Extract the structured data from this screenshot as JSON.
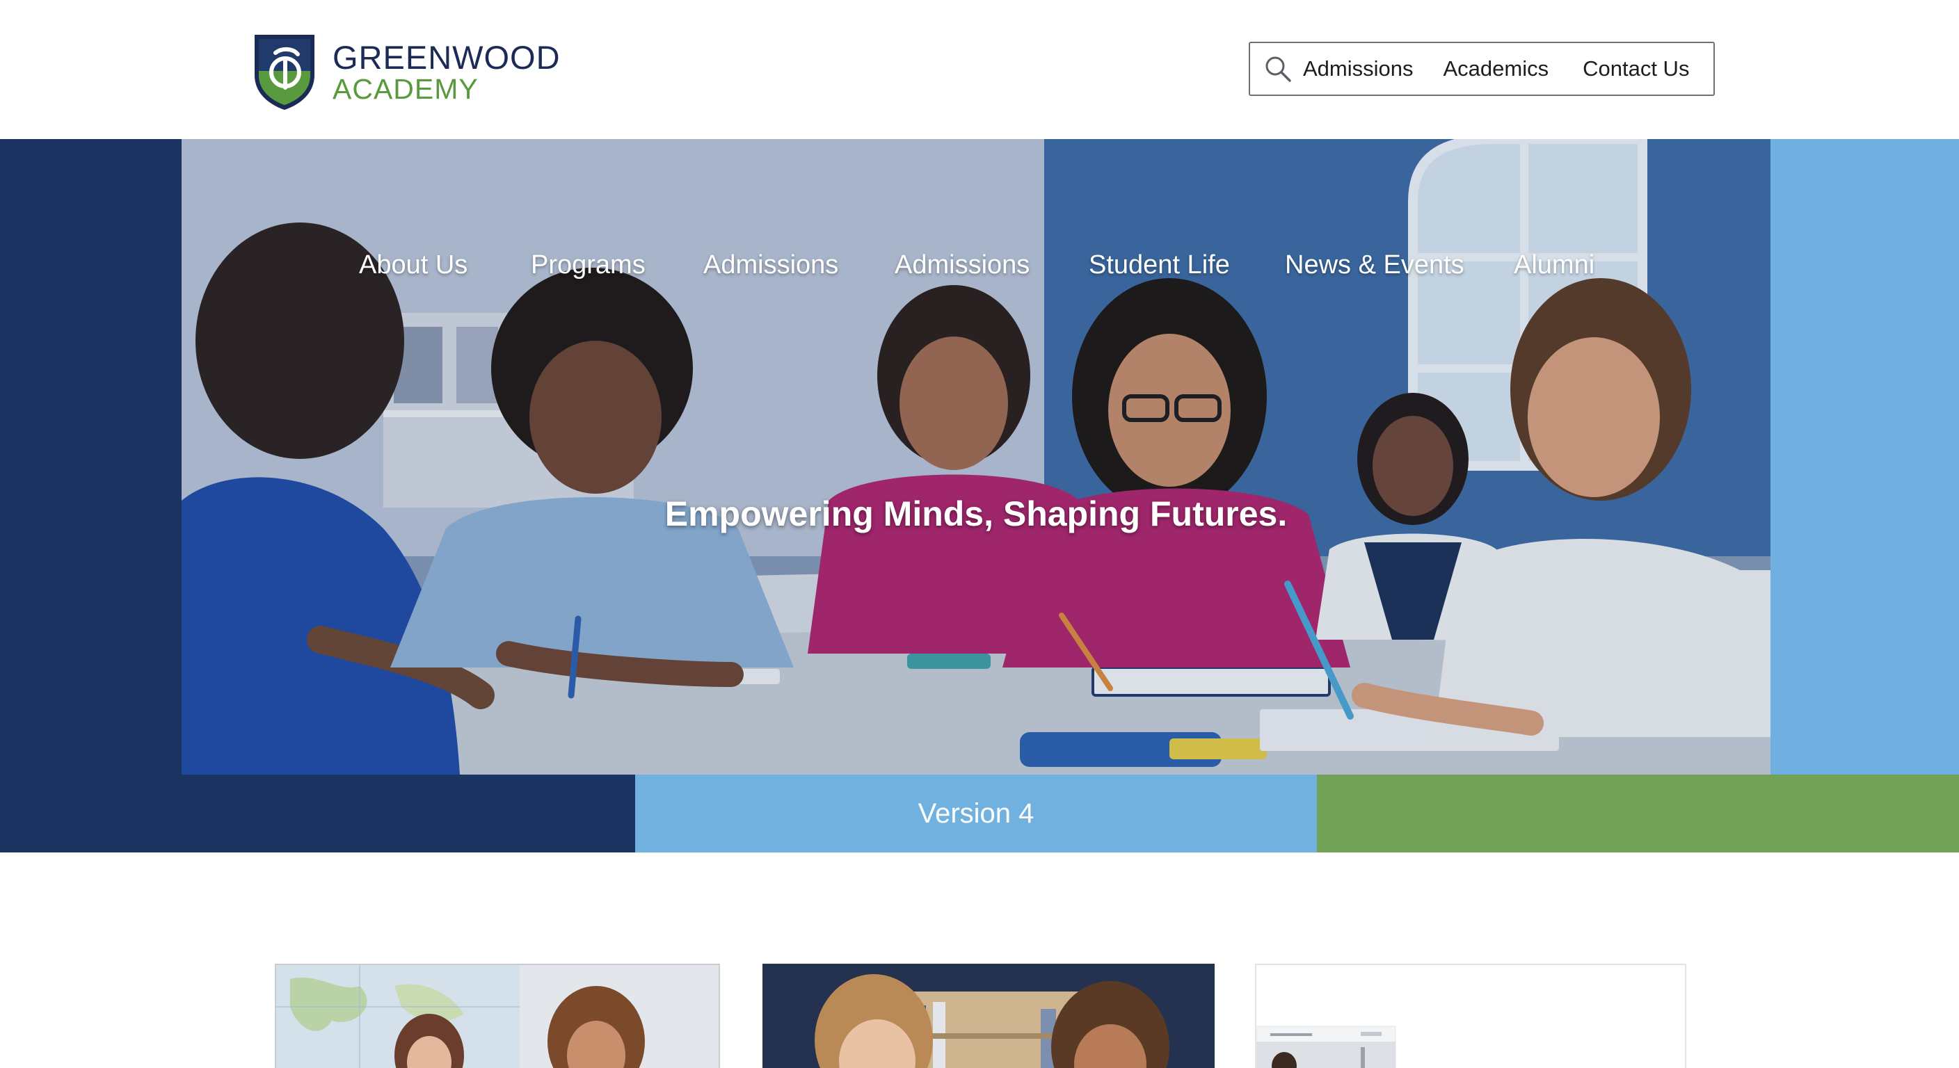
{
  "brand": {
    "name_line1": "GREENWOOD",
    "name_line2": "ACADEMY",
    "colors": {
      "navy": "#1b3461",
      "light_blue": "#71b1e0",
      "green": "#72a257"
    }
  },
  "topnav": {
    "search_icon": "search-icon",
    "items": [
      "Admissions",
      "Academics",
      "Contact Us"
    ]
  },
  "hero": {
    "nav": [
      "About Us",
      "Programs",
      "Admissions",
      "Admissions",
      "Student Life",
      "News & Events",
      "Alumni"
    ],
    "tagline": "Empowering Minds, Shaping Futures."
  },
  "strip": {
    "label": "Version 4"
  },
  "cards": [
    {
      "image": "students-with-map-photo"
    },
    {
      "image": "students-in-library-photo"
    },
    {
      "image": "website-screenshot-thumbnail"
    }
  ]
}
